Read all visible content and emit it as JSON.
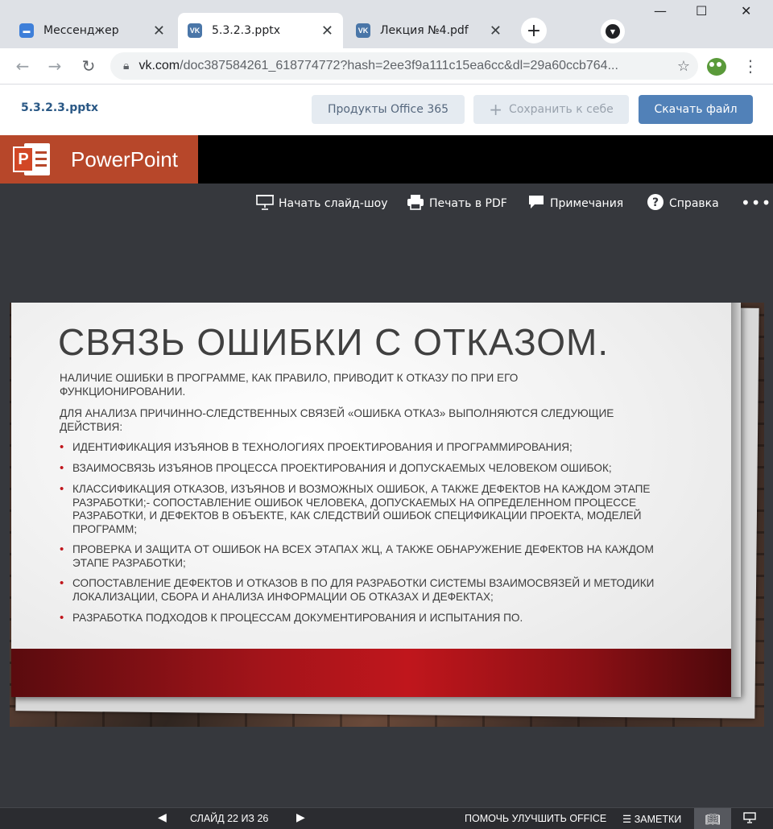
{
  "browser": {
    "tabs": [
      {
        "label": "Мессенджер",
        "icon": "messenger-icon",
        "active": false
      },
      {
        "label": "5.3.2.3.pptx",
        "icon": "vk-icon",
        "active": true
      },
      {
        "label": "Лекция №4.pdf",
        "icon": "vk-icon",
        "active": false
      }
    ],
    "new_tab": "+",
    "window": {
      "minimize": "—",
      "maximize": "☐",
      "close": "✕"
    },
    "address": {
      "domain": "vk.com",
      "path": "/doc387584261_618774772?hash=2ee3f9a111c15ea6cc&dl=29a60ccb764..."
    }
  },
  "vk": {
    "doc_name": "5.3.2.3.pptx",
    "btn_office": "Продукты Office 365",
    "btn_save": "Сохранить к себе",
    "btn_download": "Скачать файл"
  },
  "ppt": {
    "app_name": "PowerPoint",
    "commands": {
      "slideshow": "Начать слайд-шоу",
      "print": "Печать в PDF",
      "notes": "Примечания",
      "help": "Справка"
    }
  },
  "slide": {
    "title": "СВЯЗЬ ОШИБКИ С ОТКАЗОМ.",
    "para1": "НАЛИЧИЕ ОШИБКИ В ПРОГРАММЕ, КАК ПРАВИЛО, ПРИВОДИТ К ОТКАЗУ ПО ПРИ ЕГО ФУНКЦИОНИРОВАНИИ.",
    "para2": "ДЛЯ АНАЛИЗА ПРИЧИННО-СЛЕДСТВЕННЫХ СВЯЗЕЙ «ОШИБКА ОТКАЗ» ВЫПОЛНЯЮТСЯ СЛЕДУЮЩИЕ ДЕЙСТВИЯ:",
    "bullets": [
      "ИДЕНТИФИКАЦИЯ ИЗЪЯНОВ В ТЕХНОЛОГИЯХ ПРОЕКТИРОВАНИЯ И ПРОГРАММИРОВАНИЯ;",
      "ВЗАИМОСВЯЗЬ ИЗЪЯНОВ ПРОЦЕССА ПРОЕКТИРОВАНИЯ И ДОПУСКАЕМЫХ ЧЕЛОВЕКОМ ОШИБОК;",
      "КЛАССИФИКАЦИЯ ОТКАЗОВ, ИЗЪЯНОВ И ВОЗМОЖНЫХ ОШИБОК, А ТАКЖЕ ДЕФЕКТОВ НА КАЖДОМ ЭТАПЕ РАЗРАБОТКИ;- СОПОСТАВЛЕНИЕ ОШИБОК ЧЕЛОВЕКА, ДОПУСКАЕМЫХ НА ОПРЕДЕЛЕННОМ ПРОЦЕССЕ РАЗРАБОТКИ, И ДЕФЕКТОВ В ОБЪЕКТЕ, КАК СЛЕДСТВИЙ ОШИБОК СПЕЦИФИКАЦИИ ПРОЕКТА, МОДЕЛЕЙ ПРОГРАММ;",
      "ПРОВЕРКА И ЗАЩИТА ОТ ОШИБОК НА ВСЕХ ЭТАПАХ ЖЦ, А ТАКЖЕ ОБНАРУЖЕНИЕ ДЕФЕКТОВ НА КАЖДОМ ЭТАПЕ РАЗРАБОТКИ;",
      "СОПОСТАВЛЕНИЕ ДЕФЕКТОВ И ОТКАЗОВ В ПО ДЛЯ РАЗРАБОТКИ СИСТЕМЫ ВЗАИМОСВЯЗЕЙ И МЕТОДИКИ ЛОКАЛИЗАЦИИ, СБОРА И АНАЛИЗА ИНФОРМАЦИИ ОБ ОТКАЗАХ И ДЕФЕКТАХ;",
      "РАЗРАБОТКА ПОДХОДОВ К ПРОЦЕССАМ ДОКУМЕНТИРОВАНИЯ И ИСПЫТАНИЯ ПО."
    ]
  },
  "status": {
    "slide_counter": "СЛАЙД 22 ИЗ 26",
    "help_improve": "ПОМОЧЬ УЛУЧШИТЬ OFFICE",
    "notes": "ЗАМЕТКИ"
  },
  "colors": {
    "ppt_brand": "#b7472a",
    "vk_blue": "#5181b8",
    "slide_red": "#c0161c"
  }
}
